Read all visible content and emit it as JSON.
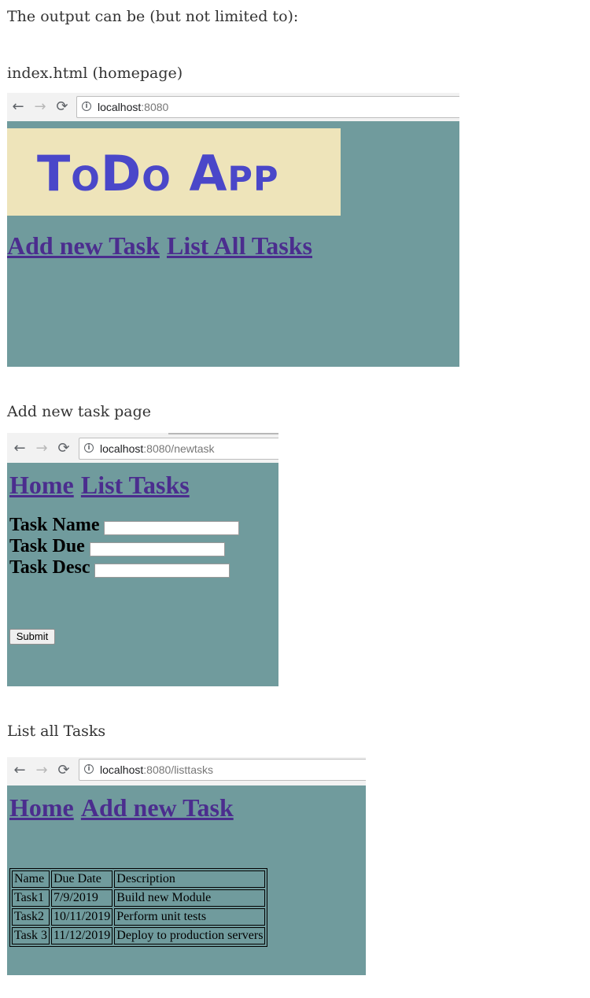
{
  "intro": "The output can be (but not limited to):",
  "sections": {
    "home": {
      "caption": "index.html (homepage)",
      "url_host": "localhost",
      "url_path": ":8080",
      "logo": "ToDo App",
      "links": [
        "Add new Task",
        "List All Tasks"
      ]
    },
    "newtask": {
      "caption": "Add new task page",
      "url_host": "localhost",
      "url_path": ":8080/newtask",
      "links": [
        "Home",
        "List Tasks"
      ],
      "fields": [
        {
          "label": "Task Name",
          "value": ""
        },
        {
          "label": "Task Due",
          "value": ""
        },
        {
          "label": "Task Desc",
          "value": ""
        }
      ],
      "submit": "Submit"
    },
    "listtasks": {
      "caption": "List all Tasks",
      "url_host": "localhost",
      "url_path": ":8080/listtasks",
      "links": [
        "Home",
        "Add new Task"
      ],
      "columns": [
        "Name",
        "Due Date",
        "Description"
      ],
      "rows": [
        [
          "Task1",
          "7/9/2019",
          "Build new Module"
        ],
        [
          "Task2",
          "10/11/2019",
          "Perform unit tests"
        ],
        [
          "Task 3",
          "11/12/2019",
          "Deploy to production servers"
        ]
      ]
    }
  },
  "icons": {
    "back": "arrow-left",
    "forward": "arrow-right",
    "reload": "reload",
    "info": "info"
  },
  "colors": {
    "page_bg": "#709b9d",
    "logo_bg": "#eee4ba",
    "logo_text": "#4a47c9",
    "link": "#4b2d8e"
  }
}
